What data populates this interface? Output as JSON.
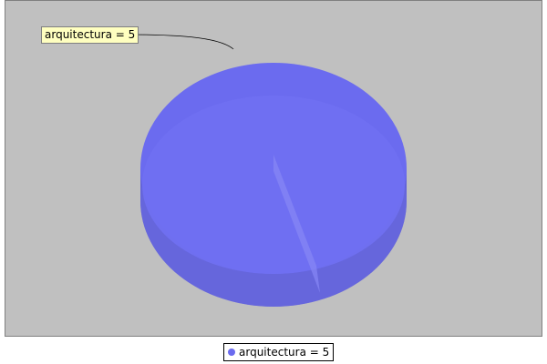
{
  "chart_data": {
    "type": "pie",
    "title": "",
    "slices": [
      {
        "label": "arquitectura",
        "value": 5,
        "color": "#6b6bef"
      }
    ],
    "slice_label_text": "arquitectura = 5",
    "legend": {
      "placement": "bottom",
      "entries": [
        {
          "text": "arquitectura = 5",
          "color": "#6b6bef"
        }
      ]
    }
  }
}
